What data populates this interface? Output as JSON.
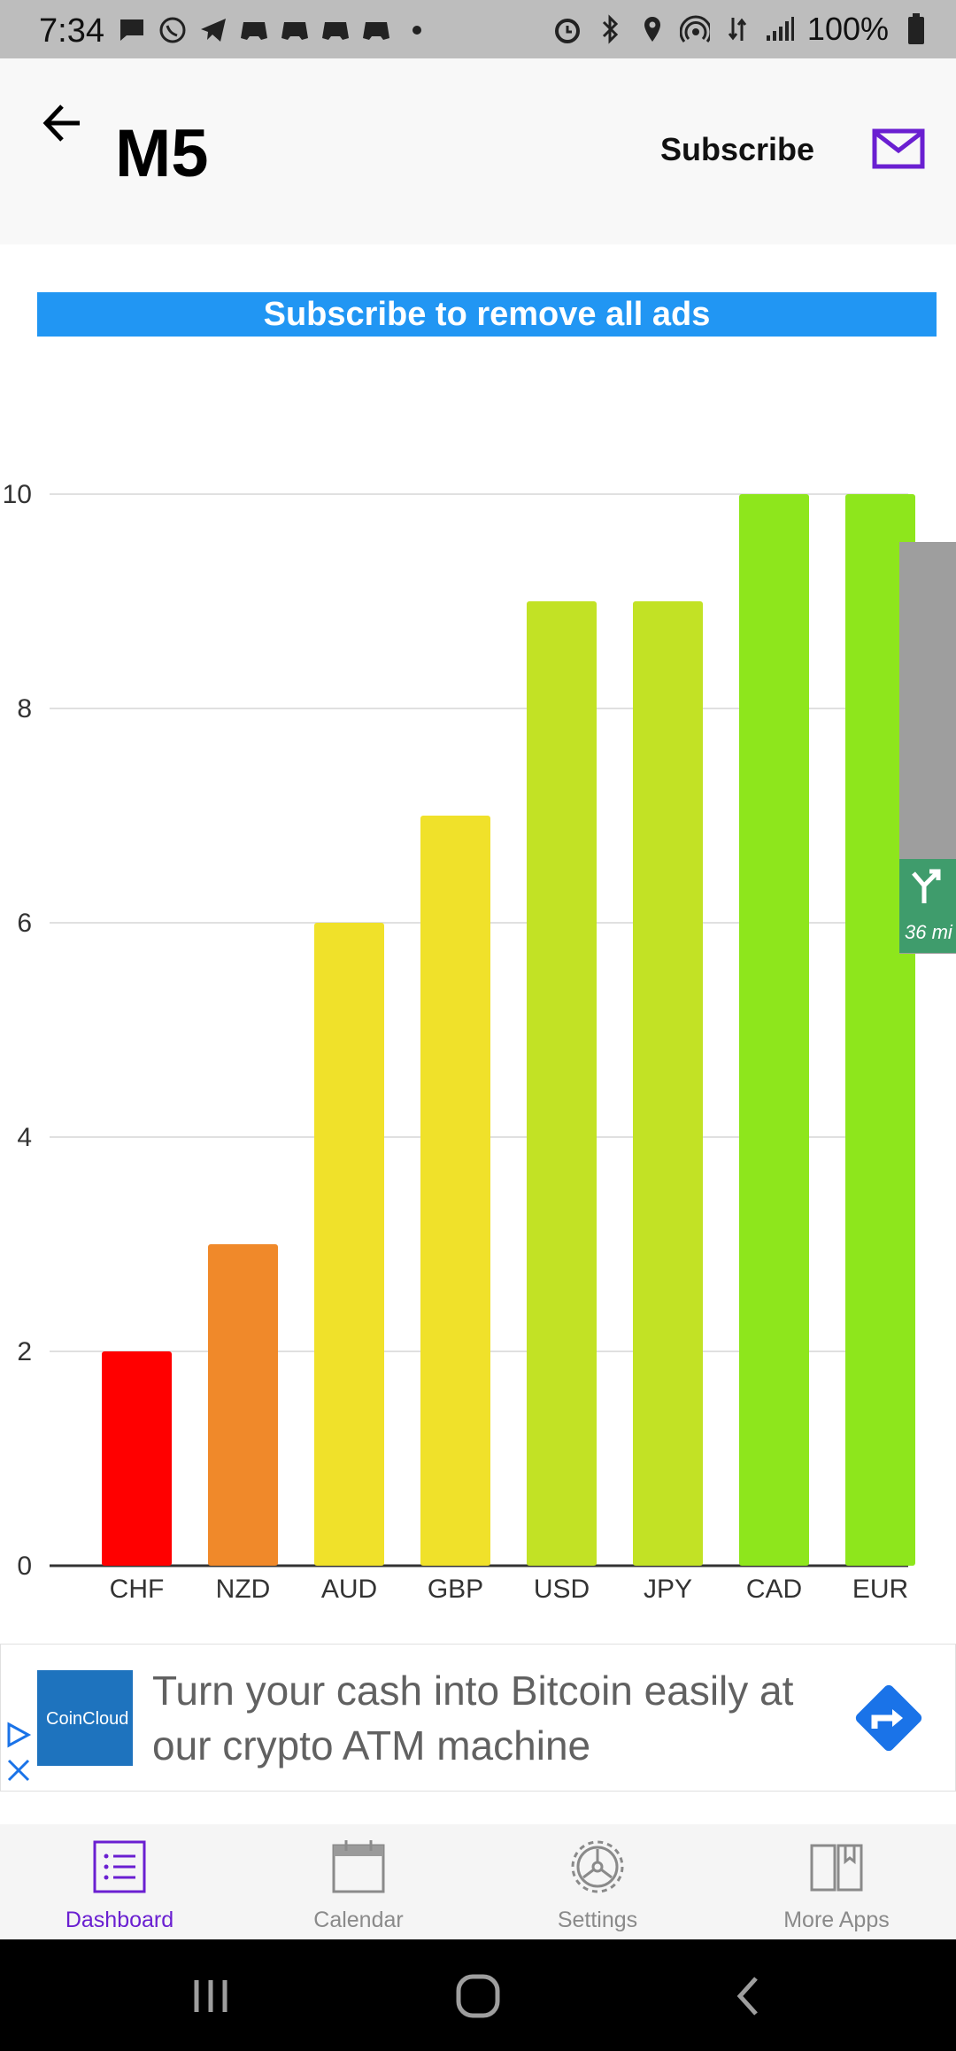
{
  "status_bar": {
    "time": "7:34",
    "battery": "100%"
  },
  "header": {
    "title": "M5",
    "subscribe_label": "Subscribe"
  },
  "banner": {
    "text": "Subscribe to remove all ads"
  },
  "chart_data": {
    "type": "bar",
    "categories": [
      "CHF",
      "NZD",
      "AUD",
      "GBP",
      "USD",
      "JPY",
      "CAD",
      "EUR"
    ],
    "values": [
      2,
      3,
      6,
      7,
      9,
      9,
      10,
      10
    ],
    "bar_colors": [
      "#ff0000",
      "#f0892a",
      "#f0e12a",
      "#f0e12a",
      "#c2e225",
      "#c2e225",
      "#8ee61c",
      "#8ee61c"
    ],
    "ylim": [
      0,
      10
    ],
    "yticks": [
      "0",
      "2",
      "4",
      "6",
      "8",
      "10"
    ],
    "grid": true
  },
  "side_overlay": {
    "distance": "36 mi"
  },
  "ad": {
    "logo_text": "CoinCloud",
    "text": "Turn your cash into Bitcoin easily at our crypto ATM machine",
    "accent": "#1a73e8"
  },
  "bottom_nav": {
    "items": [
      {
        "label": "Dashboard",
        "icon": "list-icon"
      },
      {
        "label": "Calendar",
        "icon": "calendar-icon"
      },
      {
        "label": "Settings",
        "icon": "gear-icon"
      },
      {
        "label": "More Apps",
        "icon": "book-icon"
      }
    ],
    "active_color": "#6a1fd1"
  }
}
